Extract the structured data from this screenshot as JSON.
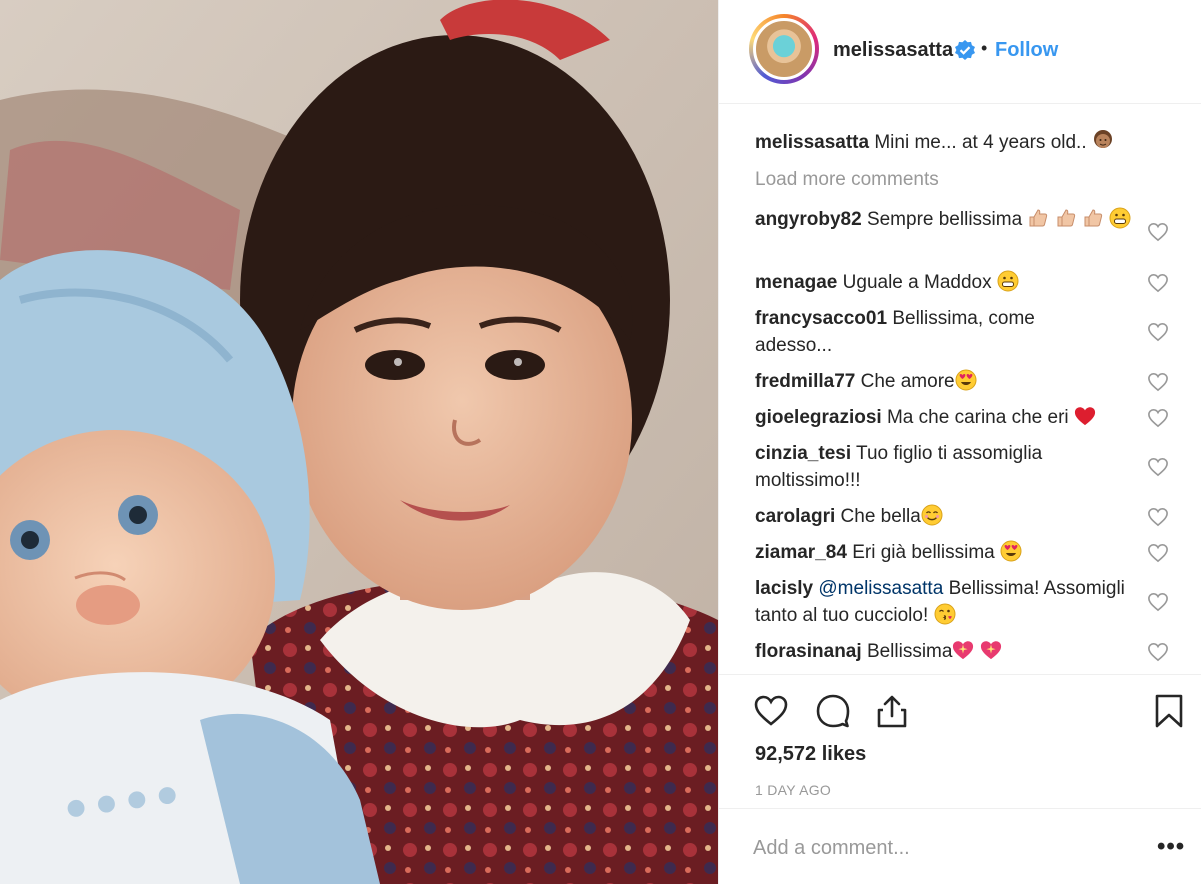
{
  "header": {
    "username": "melissasatta",
    "separator": "•",
    "follow_label": "Follow"
  },
  "caption": {
    "username": "melissasatta",
    "text": "Mini me... at 4 years old.."
  },
  "load_more_label": "Load more comments",
  "comments": [
    {
      "user": "angyroby82",
      "text": "Sempre bellissima"
    },
    {
      "user": "menagae",
      "text": "Uguale a Maddox"
    },
    {
      "user": "francysacco01",
      "text": "Bellissima, come adesso..."
    },
    {
      "user": "fredmilla77",
      "text": "Che amore"
    },
    {
      "user": "gioelegraziosi",
      "text": "Ma che carina che eri"
    },
    {
      "user": "cinzia_tesi",
      "text": "Tuo figlio ti assomiglia moltissimo!!!"
    },
    {
      "user": "carolagri",
      "text": "Che bella"
    },
    {
      "user": "ziamar_84",
      "text": "Eri già bellissima"
    },
    {
      "user": "lacisly",
      "mention": "@melissasatta",
      "text": "Bellissima! Assomigli tanto al tuo cucciolo!"
    },
    {
      "user": "florasinanaj",
      "text": "Bellissima"
    }
  ],
  "likes": "92,572 likes",
  "timestamp": "1 DAY AGO",
  "add_comment": {
    "placeholder": "Add a comment..."
  },
  "more_label": "•••",
  "colors": {
    "link": "#3897f0",
    "muted": "#999999",
    "heart_red": "#ed4956",
    "verified": "#3897f0"
  }
}
